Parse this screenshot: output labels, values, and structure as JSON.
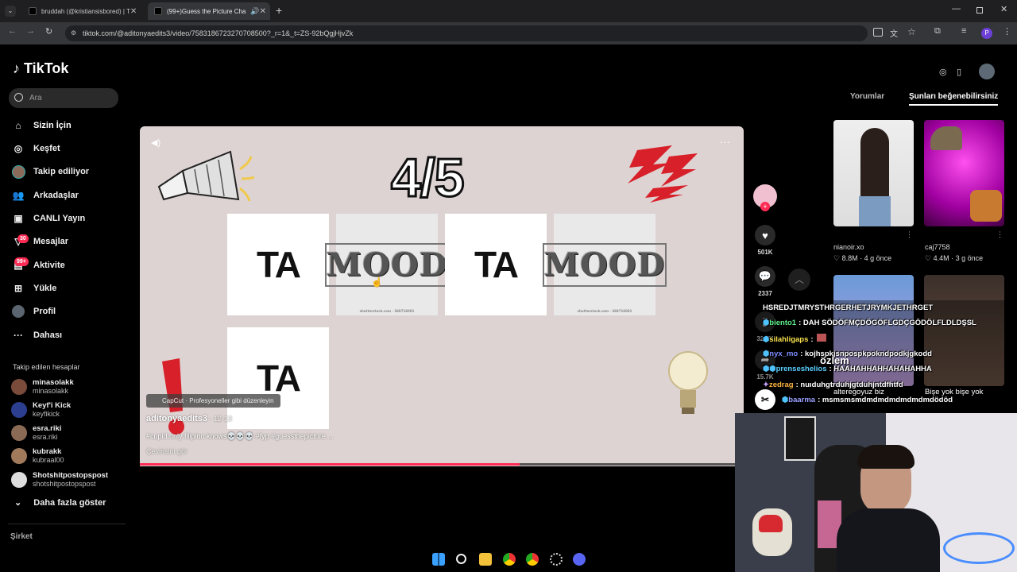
{
  "browser": {
    "tabs": [
      {
        "title": "bruddah (@kristiansisbored) | T",
        "active": false
      },
      {
        "title": "(99+)Guess the Picture Cha",
        "active": true
      }
    ],
    "url": "tiktok.com/@aditonyaedits3/video/7583186723270708500?_r=1&_t=ZS-92bQgjHjvZk"
  },
  "tiktok": {
    "logo": "TikTok",
    "search_placeholder": "Ara",
    "nav": [
      {
        "label": "Sizin İçin",
        "icon": "home-icon"
      },
      {
        "label": "Keşfet",
        "icon": "compass-icon"
      },
      {
        "label": "Takip ediliyor",
        "icon": "following-avatar-icon"
      },
      {
        "label": "Arkadaşlar",
        "icon": "friends-icon"
      },
      {
        "label": "CANLI Yayın",
        "icon": "live-icon"
      },
      {
        "label": "Mesajlar",
        "icon": "messages-icon",
        "badge": "30"
      },
      {
        "label": "Aktivite",
        "icon": "activity-icon",
        "badge": "99+"
      },
      {
        "label": "Yükle",
        "icon": "upload-icon"
      },
      {
        "label": "Profil",
        "icon": "profile-icon"
      },
      {
        "label": "Dahası",
        "icon": "more-icon"
      }
    ],
    "following_title": "Takip edilen hesaplar",
    "following": [
      {
        "name": "minasolakk",
        "handle": "minasolakk",
        "color": "#7a4a3a"
      },
      {
        "name": "Keyf'i Kick",
        "handle": "keyfikick",
        "color": "#2c3e8f"
      },
      {
        "name": "esra.riki",
        "handle": "esra.riki",
        "color": "#8a6a55"
      },
      {
        "name": "kubrakk",
        "handle": "kubraal00",
        "color": "#a07a5a"
      },
      {
        "name": "Shotshitpostopspost",
        "handle": "shotshitpostopspost",
        "color": "#dddddd"
      }
    ],
    "show_more": "Daha fazla göster",
    "company": "Şirket"
  },
  "video": {
    "counter": "4/5",
    "cells": [
      "TA",
      "MOOD",
      "TA",
      "MOOD",
      "TA"
    ],
    "capcut_label": "CapCut · Profesyoneller gibi düzenleyin",
    "author": "aditonyaedits3",
    "date": " · 12-13",
    "caption": "#cupid only filipino knows💀💀💀 #fyp #guessthepicture ...",
    "translate": "Çevirisini gör",
    "progress": 0.637
  },
  "actions": {
    "likes": "501K",
    "comments": "2337",
    "saves": "32.5K",
    "shares": "15.7K"
  },
  "right_panel": {
    "tab_comments": "Yorumlar",
    "tab_like": "Şunları beğenebilirsiniz",
    "thumbs": [
      {
        "user": "nianoir.xo",
        "likes": "8.8M",
        "ago": "4 g önce"
      },
      {
        "user": "caj7758",
        "likes": "4.4M",
        "ago": "3 g önce"
      }
    ],
    "thumb_captions": [
      "alteregoyuz biz",
      "Bişe yok bişe yok"
    ]
  },
  "chat": {
    "messages": [
      {
        "user": "",
        "text": "HSREDJTMRYSTHRGERHETJRYMKJETHRGET"
      },
      {
        "user": "biento1",
        "text": ": DAH SÖDÖFMÇDÖGÖFLGDÇGÖDÖLFLDLDŞSL"
      },
      {
        "user": "silahligaps",
        "text": ":"
      },
      {
        "user": "nyx_mo",
        "text": ": kojhspkjsnpospkpokndpodkjgkodd"
      },
      {
        "user": "prenseshelios",
        "text": ": HAAHAHHAHHAHAHAHHA"
      },
      {
        "user": "zedrag",
        "text": ": nuıduhgtrduhjgtduhjntdfhtfd"
      },
      {
        "user": "baarma",
        "text": ": msmsmsmdmdmdmdmdmdmdödöd"
      }
    ],
    "overlay_word": "özlem"
  }
}
